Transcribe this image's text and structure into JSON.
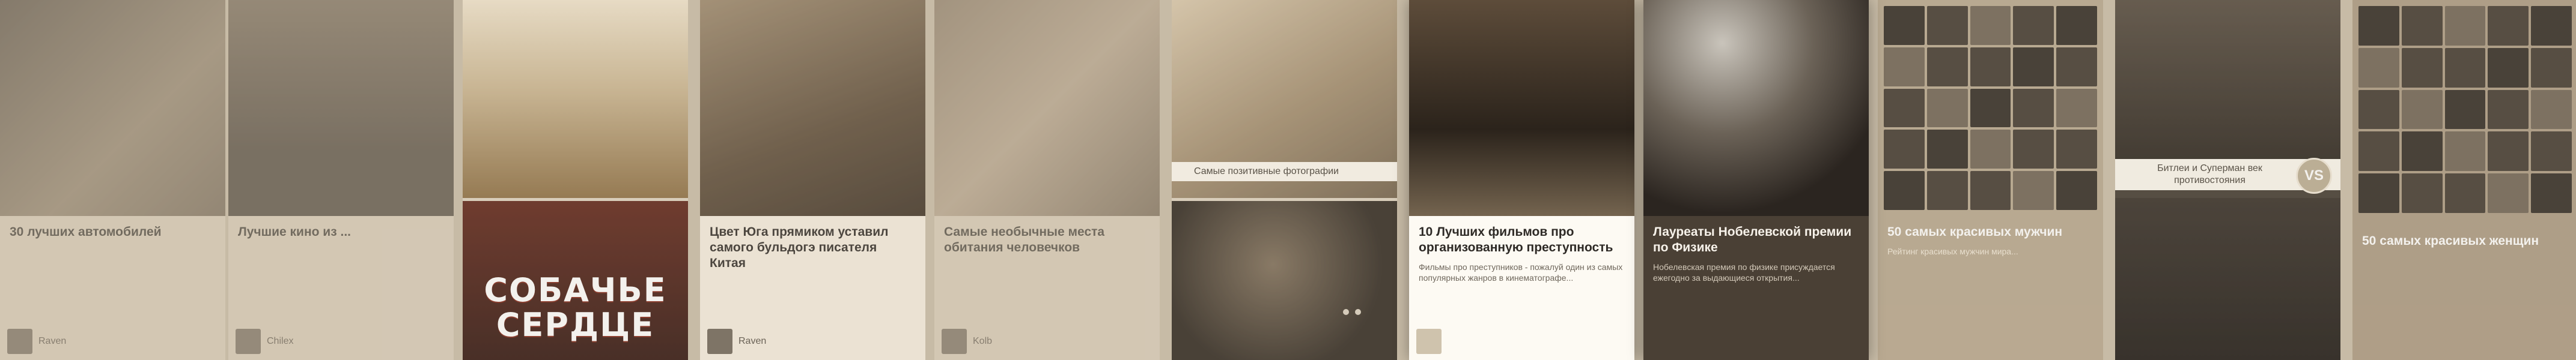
{
  "cards": [
    {
      "title": "30 лучших автомобилей",
      "desc": "",
      "author": "Raven",
      "poster_text": ""
    },
    {
      "title": "Лучшие кино из ...",
      "desc": "",
      "author": "Chilex",
      "poster_text": ""
    },
    {
      "title": "",
      "desc": "",
      "author": "",
      "poster_text_line1": "СОБАЧЬЕ",
      "poster_text_line2": "СЕРДЦЕ"
    },
    {
      "title": "Цвет Юга прямиком уставил самого бульдогэ писателя Китая",
      "desc": "",
      "author": "Raven"
    },
    {
      "title": "Самые необычные места обитания человечков",
      "desc": "",
      "author": "Kolb"
    },
    {
      "banner": "Самые позитивные фотографии",
      "title": "",
      "desc": "",
      "author": ""
    },
    {
      "title": "10 Лучших фильмов про организованную преступность",
      "desc": "Фильмы про преступников - пожалуй один из самых популярных жанров в кинематографе...",
      "author": ""
    },
    {
      "title": "Лауреаты Нобелевской премии по Физике",
      "desc": "Нобелевская премия по физике присуждается ежегодно за выдающиеся открытия...",
      "author": ""
    },
    {
      "title": "50 самых красивых мужчин",
      "desc": "Рейтинг красивых мужчин мира...",
      "author": ""
    },
    {
      "banner": "Битлеи и Суперман век противостояния",
      "badge": "VS",
      "title": "",
      "desc": "",
      "author": ""
    },
    {
      "title": "50 самых красивых женщин",
      "desc": "",
      "author": ""
    }
  ],
  "colors": {
    "overlay": "#c7bba6",
    "card_bright": "#fdfaf3",
    "badge": "#b9ab92"
  }
}
